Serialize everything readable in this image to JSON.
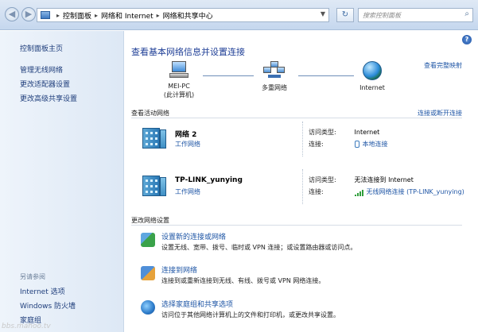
{
  "address": {
    "crumbs": [
      "控制面板",
      "网络和 Internet",
      "网络和共享中心"
    ],
    "search_placeholder": "搜索控制面板"
  },
  "left": {
    "home": "控制面板主页",
    "links": [
      "管理无线网络",
      "更改适配器设置",
      "更改高级共享设置"
    ],
    "see_also_label": "另请参阅",
    "see_also": [
      "Internet 选项",
      "Windows 防火墙",
      "家庭组"
    ]
  },
  "main": {
    "title": "查看基本网络信息并设置连接",
    "full_map": "查看完整映射",
    "nodes": {
      "pc_line1": "MEI-PC",
      "pc_line2": "(此计算机)",
      "multi": "多重网络",
      "internet": "Internet"
    },
    "active_title": "查看活动网络",
    "connect_disconnect": "连接或断开连接",
    "networks": [
      {
        "name": "网络  2",
        "type": "工作网络",
        "access_label": "访问类型:",
        "access_value": "Internet",
        "conn_label": "连接:",
        "conn_value": "本地连接"
      },
      {
        "name": "TP-LINK_yunying",
        "type": "工作网络",
        "access_label": "访问类型:",
        "access_value": "无法连接到 Internet",
        "conn_label": "连接:",
        "conn_value": "无线网络连接 (TP-LINK_yunying)"
      }
    ],
    "change_title": "更改网络设置",
    "tasks": [
      {
        "link": "设置新的连接或网络",
        "desc": "设置无线、宽带、拨号、临时或 VPN 连接；或设置路由器或访问点。"
      },
      {
        "link": "连接到网络",
        "desc": "连接到或重新连接到无线、有线、拨号或 VPN 网络连接。"
      },
      {
        "link": "选择家庭组和共享选项",
        "desc": "访问位于其他网络计算机上的文件和打印机，或更改共享设置。"
      }
    ]
  },
  "watermark": "bbs.mahoo.tv"
}
